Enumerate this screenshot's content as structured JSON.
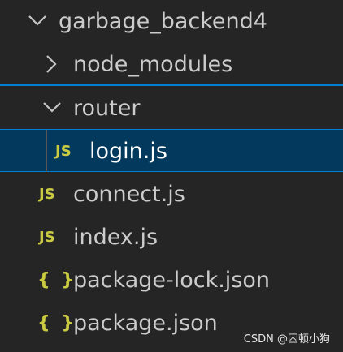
{
  "explorer": {
    "root": {
      "label": "garbage_backend4",
      "expanded": true
    },
    "node_modules": {
      "label": "node_modules",
      "expanded": false
    },
    "router": {
      "label": "router",
      "expanded": true
    },
    "login": {
      "label": "login.js",
      "icon": "js-icon",
      "icon_text": "JS",
      "selected": true
    },
    "connect": {
      "label": "connect.js",
      "icon": "js-icon",
      "icon_text": "JS"
    },
    "index": {
      "label": "index.js",
      "icon": "js-icon",
      "icon_text": "JS"
    },
    "package_lock": {
      "label": "package-lock.json",
      "icon": "json-icon",
      "icon_text": "{ }"
    },
    "package": {
      "label": "package.json",
      "icon": "json-icon",
      "icon_text": "{ }"
    }
  },
  "colors": {
    "background": "#252526",
    "selected_background": "#04395e",
    "focus_border": "#007fd4",
    "js_icon": "#cbcb41",
    "text": "#cccccc"
  },
  "watermark": {
    "text": "CSDN @困顿小狗"
  }
}
